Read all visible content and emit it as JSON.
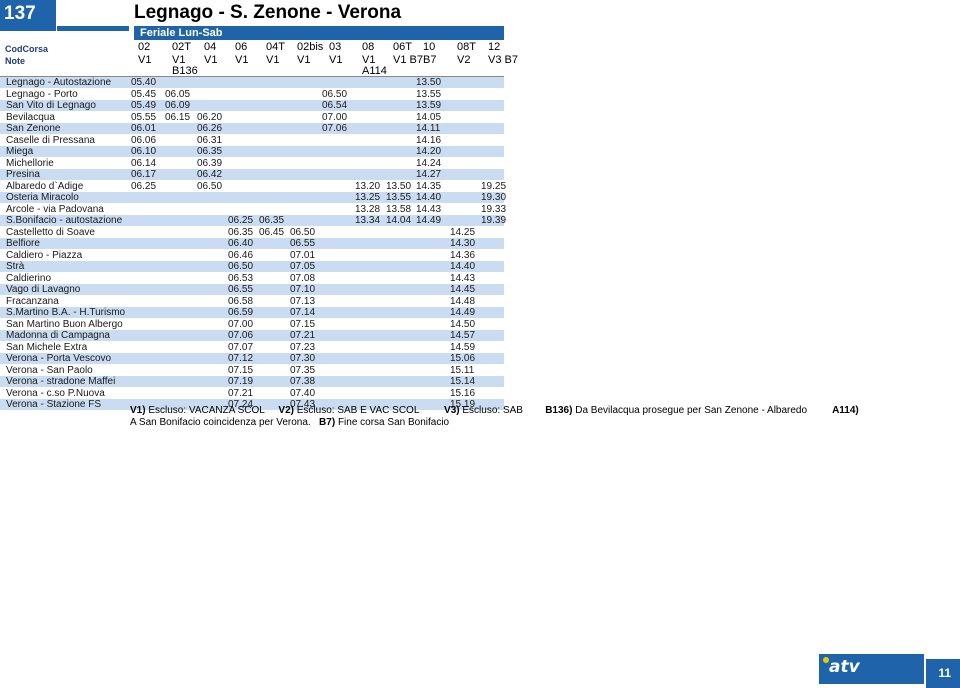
{
  "route": {
    "number": "137",
    "title": "Legnago - S. Zenone - Verona",
    "day": "Feriale Lun-Sab"
  },
  "labels": {
    "codcorsa": "CodCorsa",
    "note": "Note"
  },
  "columns": [
    {
      "code": "02",
      "note": "V1",
      "note2": ""
    },
    {
      "code": "02T",
      "note": "V1",
      "note2": "B136"
    },
    {
      "code": "04",
      "note": "V1",
      "note2": ""
    },
    {
      "code": "06",
      "note": "V1",
      "note2": ""
    },
    {
      "code": "04T",
      "note": "V1",
      "note2": ""
    },
    {
      "code": "02bis",
      "note": "V1",
      "note2": ""
    },
    {
      "code": "03",
      "note": "V1",
      "note2": ""
    },
    {
      "code": "08",
      "note": "V1",
      "note2": "A114"
    },
    {
      "code": "06T",
      "note": "V1 B7",
      "note2": ""
    },
    {
      "code": "10",
      "note": "B7",
      "note2": ""
    },
    {
      "code": "08T",
      "note": "V2",
      "note2": ""
    },
    {
      "code": "12",
      "note": "V3 B7",
      "note2": ""
    }
  ],
  "rows": [
    {
      "stop": "Legnago - Autostazione",
      "times": [
        "05.40",
        "",
        "",
        "",
        "",
        "",
        "",
        "",
        "",
        "13.50",
        "",
        ""
      ]
    },
    {
      "stop": "Legnago - Porto",
      "times": [
        "05.45",
        "06.05",
        "",
        "",
        "",
        "",
        "06.50",
        "",
        "",
        "13.55",
        "",
        ""
      ]
    },
    {
      "stop": "San Vito di Legnago",
      "times": [
        "05.49",
        "06.09",
        "",
        "",
        "",
        "",
        "06.54",
        "",
        "",
        "13.59",
        "",
        ""
      ]
    },
    {
      "stop": "Bevilacqua",
      "times": [
        "05.55",
        "06.15",
        "06.20",
        "",
        "",
        "",
        "07.00",
        "",
        "",
        "14.05",
        "",
        ""
      ]
    },
    {
      "stop": "San Zenone",
      "times": [
        "06.01",
        "",
        "06.26",
        "",
        "",
        "",
        "07.06",
        "",
        "",
        "14.11",
        "",
        ""
      ]
    },
    {
      "stop": "Caselle di Pressana",
      "times": [
        "06.06",
        "",
        "06.31",
        "",
        "",
        "",
        "",
        "",
        "",
        "14.16",
        "",
        ""
      ]
    },
    {
      "stop": "Miega",
      "times": [
        "06.10",
        "",
        "06.35",
        "",
        "",
        "",
        "",
        "",
        "",
        "14.20",
        "",
        ""
      ]
    },
    {
      "stop": "Michellorie",
      "times": [
        "06.14",
        "",
        "06.39",
        "",
        "",
        "",
        "",
        "",
        "",
        "14.24",
        "",
        ""
      ]
    },
    {
      "stop": "Presina",
      "times": [
        "06.17",
        "",
        "06.42",
        "",
        "",
        "",
        "",
        "",
        "",
        "14.27",
        "",
        ""
      ]
    },
    {
      "stop": "Albaredo d`Adige",
      "times": [
        "06.25",
        "",
        "06.50",
        "",
        "",
        "",
        "",
        "13.20",
        "13.50",
        "14.35",
        "",
        "19.25"
      ]
    },
    {
      "stop": "Osteria Miracolo",
      "times": [
        "",
        "",
        "",
        "",
        "",
        "",
        "",
        "13.25",
        "13.55",
        "14.40",
        "",
        "19.30"
      ]
    },
    {
      "stop": "Arcole - via Padovana",
      "times": [
        "",
        "",
        "",
        "",
        "",
        "",
        "",
        "13.28",
        "13.58",
        "14.43",
        "",
        "19.33"
      ]
    },
    {
      "stop": "S.Bonifacio - autostazione",
      "times": [
        "",
        "",
        "",
        "06.25",
        "06.35",
        "",
        "",
        "13.34",
        "14.04",
        "14.49",
        "",
        "19.39"
      ]
    },
    {
      "stop": "Castelletto di Soave",
      "times": [
        "",
        "",
        "",
        "06.35",
        "06.45",
        "06.50",
        "",
        "",
        "",
        "",
        "14.25",
        ""
      ]
    },
    {
      "stop": "Belfiore",
      "times": [
        "",
        "",
        "",
        "06.40",
        "",
        "06.55",
        "",
        "",
        "",
        "",
        "14.30",
        ""
      ]
    },
    {
      "stop": "Caldiero - Piazza",
      "times": [
        "",
        "",
        "",
        "06.46",
        "",
        "07.01",
        "",
        "",
        "",
        "",
        "14.36",
        ""
      ]
    },
    {
      "stop": "Strà",
      "times": [
        "",
        "",
        "",
        "06.50",
        "",
        "07.05",
        "",
        "",
        "",
        "",
        "14.40",
        ""
      ]
    },
    {
      "stop": "Caldierino",
      "times": [
        "",
        "",
        "",
        "06.53",
        "",
        "07.08",
        "",
        "",
        "",
        "",
        "14.43",
        ""
      ]
    },
    {
      "stop": "Vago di Lavagno",
      "times": [
        "",
        "",
        "",
        "06.55",
        "",
        "07.10",
        "",
        "",
        "",
        "",
        "14.45",
        ""
      ]
    },
    {
      "stop": "Fracanzana",
      "times": [
        "",
        "",
        "",
        "06.58",
        "",
        "07.13",
        "",
        "",
        "",
        "",
        "14.48",
        ""
      ]
    },
    {
      "stop": "S.Martino B.A. - H.Turismo",
      "times": [
        "",
        "",
        "",
        "06.59",
        "",
        "07.14",
        "",
        "",
        "",
        "",
        "14.49",
        ""
      ]
    },
    {
      "stop": "San Martino Buon Albergo",
      "times": [
        "",
        "",
        "",
        "07.00",
        "",
        "07.15",
        "",
        "",
        "",
        "",
        "14.50",
        ""
      ]
    },
    {
      "stop": "Madonna di Campagna",
      "times": [
        "",
        "",
        "",
        "07.06",
        "",
        "07.21",
        "",
        "",
        "",
        "",
        "14.57",
        ""
      ]
    },
    {
      "stop": "San Michele Extra",
      "times": [
        "",
        "",
        "",
        "07.07",
        "",
        "07.23",
        "",
        "",
        "",
        "",
        "14.59",
        ""
      ]
    },
    {
      "stop": "Verona - Porta Vescovo",
      "times": [
        "",
        "",
        "",
        "07.12",
        "",
        "07.30",
        "",
        "",
        "",
        "",
        "15.06",
        ""
      ]
    },
    {
      "stop": "Verona - San Paolo",
      "times": [
        "",
        "",
        "",
        "07.15",
        "",
        "07.35",
        "",
        "",
        "",
        "",
        "15.11",
        ""
      ]
    },
    {
      "stop": "Verona - stradone Maffei",
      "times": [
        "",
        "",
        "",
        "07.19",
        "",
        "07.38",
        "",
        "",
        "",
        "",
        "15.14",
        ""
      ]
    },
    {
      "stop": "Verona - c.so P.Nuova",
      "times": [
        "",
        "",
        "",
        "07.21",
        "",
        "07.40",
        "",
        "",
        "",
        "",
        "15.16",
        ""
      ]
    },
    {
      "stop": "Verona - Stazione FS",
      "times": [
        "",
        "",
        "",
        "07.24",
        "",
        "07.43",
        "",
        "",
        "",
        "",
        "15.19",
        ""
      ]
    }
  ],
  "footnotes": [
    {
      "key": "V1)",
      "text": "Escluso: VACANZA SCOL"
    },
    {
      "key": "V2)",
      "text": "Escluso: SAB E VAC SCOL"
    },
    {
      "key": "V3)",
      "text": "Escluso: SAB"
    },
    {
      "key": "B136)",
      "text": "Da Bevilacqua prosegue per San Zenone - Albaredo"
    },
    {
      "key": "A114)",
      "text": "A San Bonifacio coincidenza per Verona."
    },
    {
      "key": "B7)",
      "text": "Fine corsa San Bonifacio"
    }
  ],
  "brand": {
    "name": "atv"
  },
  "page_number": "11",
  "colors": {
    "brand_blue": "#1f64ab",
    "row_band": "#c9dcf2"
  }
}
